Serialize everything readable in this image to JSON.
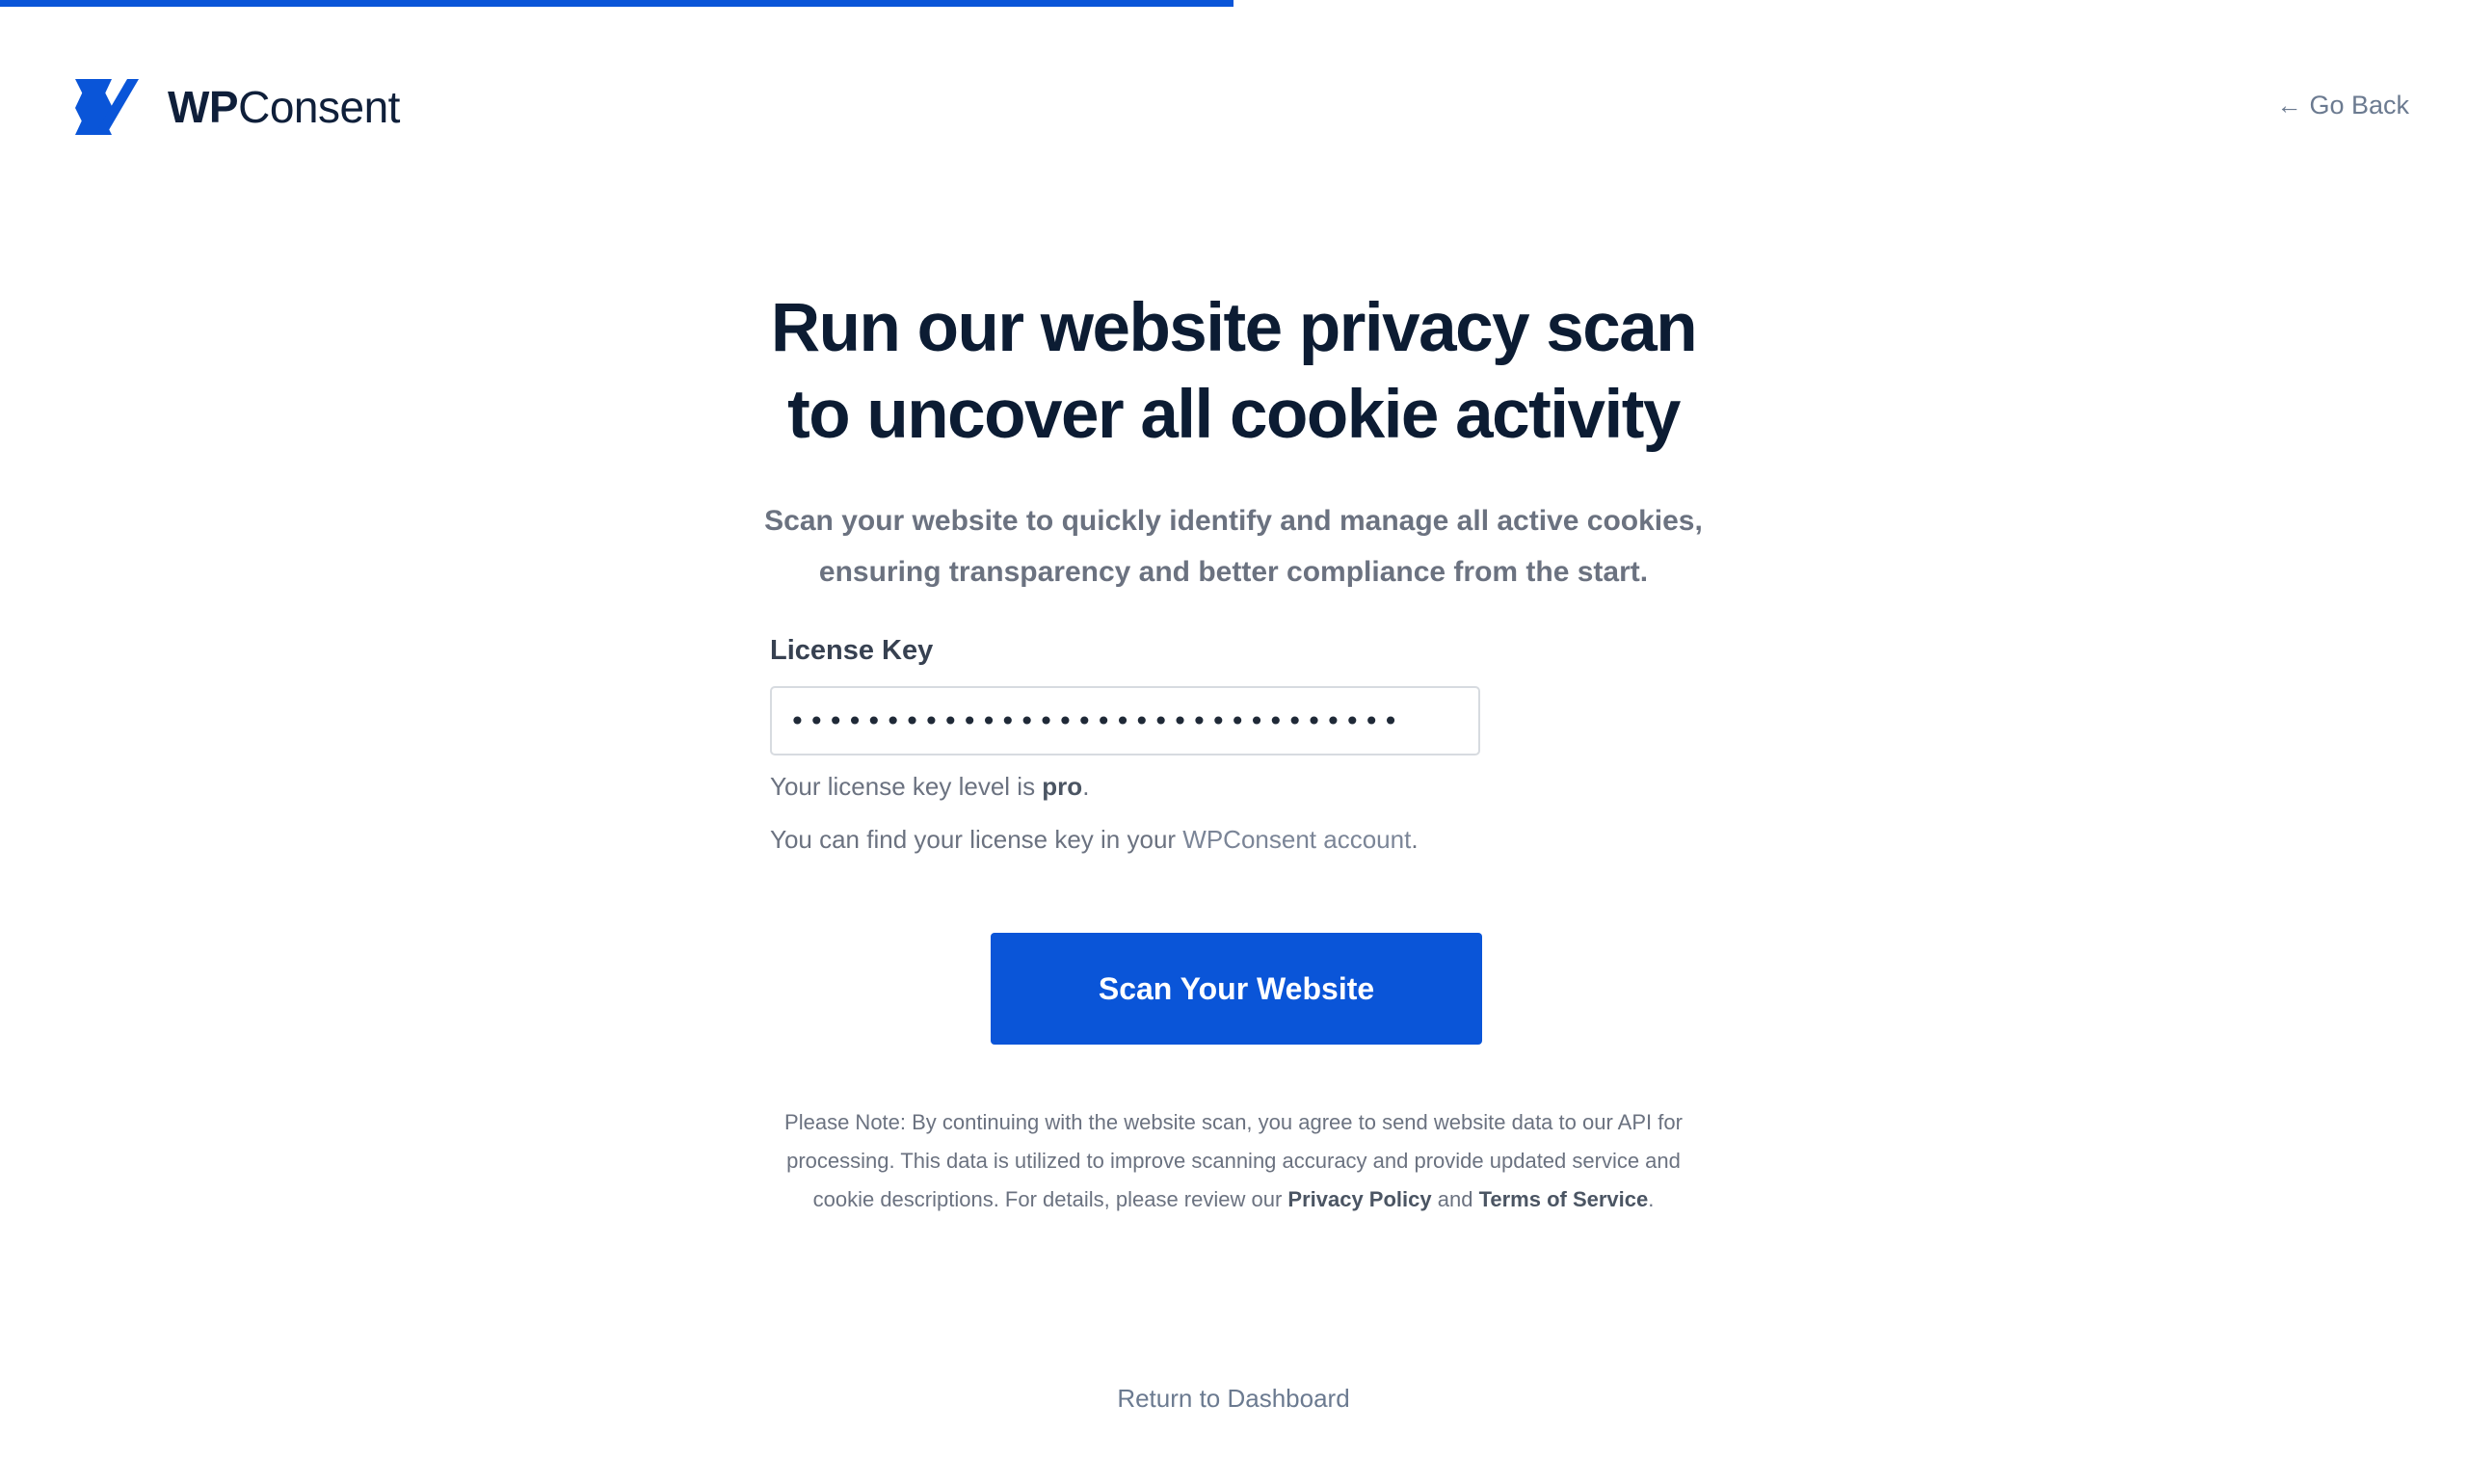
{
  "progress": {
    "fraction": 0.5
  },
  "header": {
    "logo": {
      "wp": "WP",
      "consent": "Consent"
    },
    "go_back": {
      "arrow": "←",
      "label": "Go Back"
    }
  },
  "main": {
    "headline_line1": "Run our website privacy scan",
    "headline_line2": "to uncover all cookie activity",
    "subhead_line1": "Scan your website to quickly identify and manage all active cookies,",
    "subhead_line2": "ensuring transparency and better compliance from the start.",
    "license": {
      "label": "License Key",
      "value": "································",
      "level_prefix": "Your license key level is ",
      "level_value": "pro",
      "level_suffix": ".",
      "find_prefix": "You can find your license key in your ",
      "find_link": "WPConsent account",
      "find_suffix": "."
    },
    "scan_button": "Scan Your Website",
    "note": {
      "text": "Please Note: By continuing with the website scan, you agree to send website data to our API for processing. This data is utilized to improve scanning accuracy and provide updated service and cookie descriptions. For details, please review our ",
      "privacy_link": "Privacy Policy",
      "and": " and ",
      "terms_link": "Terms of Service",
      "end": "."
    },
    "return_link": "Return to Dashboard"
  },
  "colors": {
    "accent": "#0a55d8",
    "heading": "#0c1c33",
    "muted": "#6b7280"
  },
  "icons": {
    "logo": "wpconsent-logo-icon",
    "back": "arrow-left-icon"
  }
}
